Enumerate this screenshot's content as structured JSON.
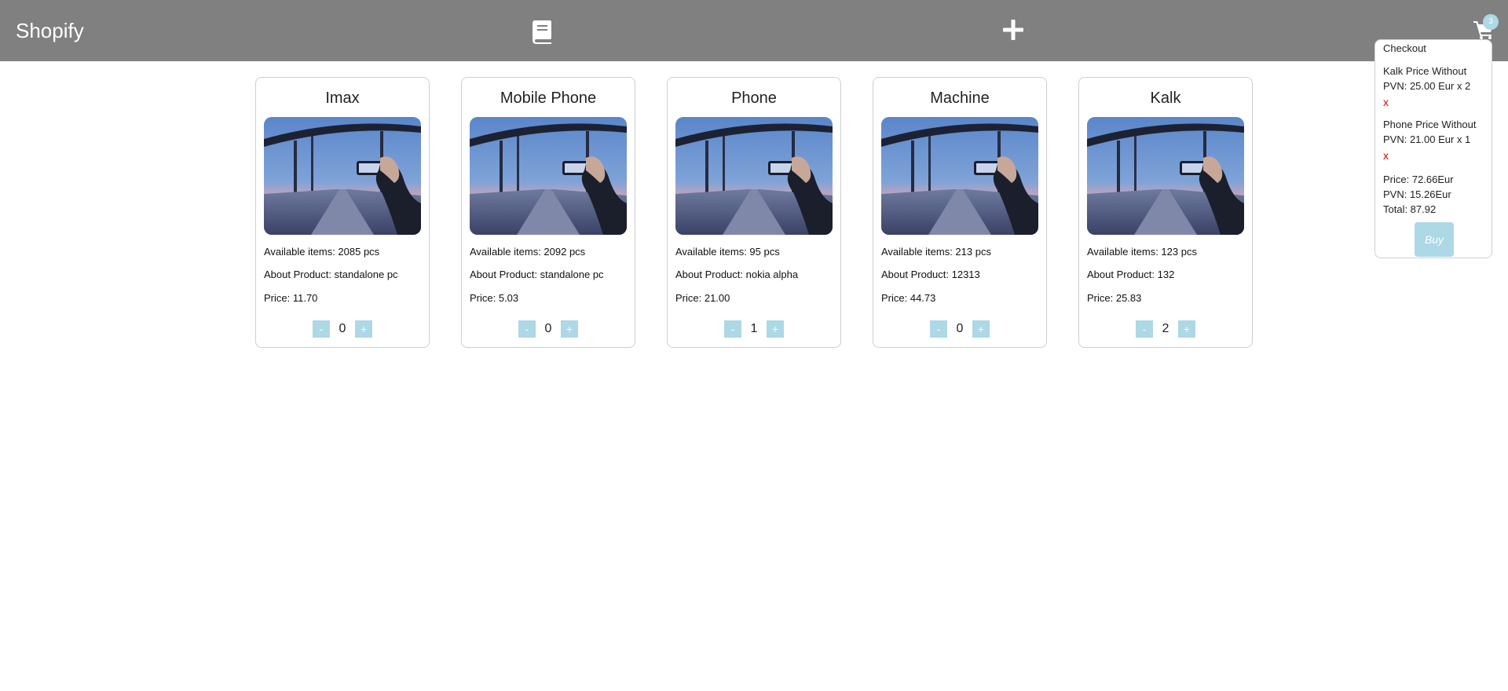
{
  "navbar": {
    "brand": "Shopify",
    "icons": [
      "book-icon",
      "plus-icon",
      "cart-icon"
    ],
    "cart_count": "3",
    "background": "#808080"
  },
  "products": [
    {
      "title": "Imax",
      "stock": "Available items: 2085 pcs",
      "about": "About Product: standalone pc",
      "price": "Price: 11.70",
      "minus": "-",
      "qty": "0",
      "plus": "+"
    },
    {
      "title": "Mobile Phone",
      "stock": "Available items: 2092 pcs",
      "about": "About Product: standalone pc",
      "price": "Price: 5.03",
      "minus": "-",
      "qty": "0",
      "plus": "+"
    },
    {
      "title": "Phone",
      "stock": "Available items: 95 pcs",
      "about": "About Product: nokia alpha",
      "price": "Price: 21.00",
      "minus": "-",
      "qty": "1",
      "plus": "+"
    },
    {
      "title": "Machine",
      "stock": "Available items: 213 pcs",
      "about": "About Product: 12313",
      "price": "Price: 44.73",
      "minus": "-",
      "qty": "0",
      "plus": "+"
    },
    {
      "title": "Kalk",
      "stock": "Available items: 123 pcs",
      "about": "About Product: 132",
      "price": "Price: 25.83",
      "minus": "-",
      "qty": "2",
      "plus": "+"
    }
  ],
  "checkout": {
    "title": "Checkout",
    "items": [
      {
        "line1": "Kalk Price Without",
        "line2": "PVN: 25.00 Eur x 2",
        "remove": "x"
      },
      {
        "line1": "Phone Price Without",
        "line2": "PVN: 21.00 Eur x 1",
        "remove": "x"
      }
    ],
    "price": "Price: 72.66Eur",
    "pvn": "PVN: 15.26Eur",
    "total": "Total: 87.92",
    "buy_label": "Buy"
  },
  "colors": {
    "accent": "#add8e6",
    "remove": "#e00000",
    "border": "#cfcfcf"
  }
}
